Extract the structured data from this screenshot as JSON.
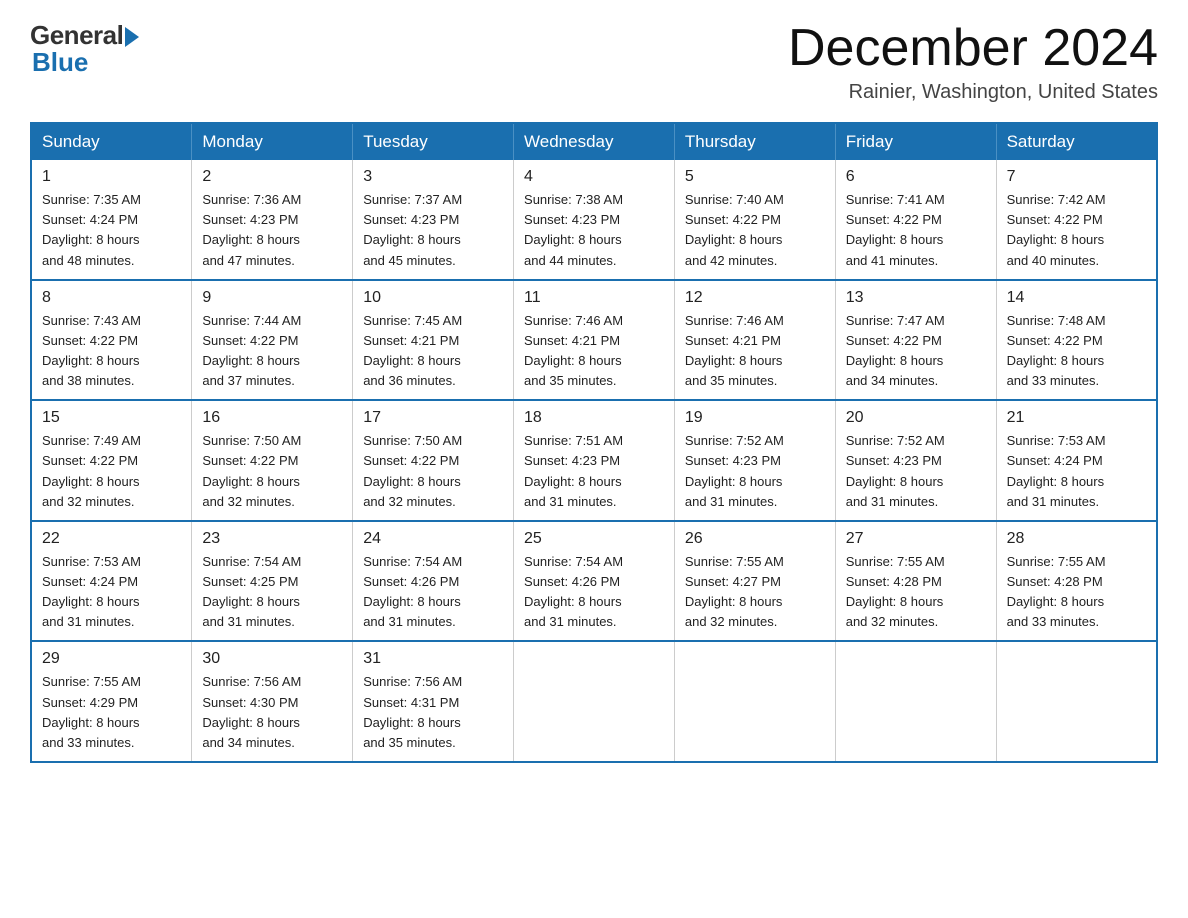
{
  "header": {
    "logo_general": "General",
    "logo_blue": "Blue",
    "month_title": "December 2024",
    "location": "Rainier, Washington, United States"
  },
  "days_of_week": [
    "Sunday",
    "Monday",
    "Tuesday",
    "Wednesday",
    "Thursday",
    "Friday",
    "Saturday"
  ],
  "weeks": [
    [
      {
        "day": "1",
        "sunrise": "7:35 AM",
        "sunset": "4:24 PM",
        "daylight": "8 hours and 48 minutes."
      },
      {
        "day": "2",
        "sunrise": "7:36 AM",
        "sunset": "4:23 PM",
        "daylight": "8 hours and 47 minutes."
      },
      {
        "day": "3",
        "sunrise": "7:37 AM",
        "sunset": "4:23 PM",
        "daylight": "8 hours and 45 minutes."
      },
      {
        "day": "4",
        "sunrise": "7:38 AM",
        "sunset": "4:23 PM",
        "daylight": "8 hours and 44 minutes."
      },
      {
        "day": "5",
        "sunrise": "7:40 AM",
        "sunset": "4:22 PM",
        "daylight": "8 hours and 42 minutes."
      },
      {
        "day": "6",
        "sunrise": "7:41 AM",
        "sunset": "4:22 PM",
        "daylight": "8 hours and 41 minutes."
      },
      {
        "day": "7",
        "sunrise": "7:42 AM",
        "sunset": "4:22 PM",
        "daylight": "8 hours and 40 minutes."
      }
    ],
    [
      {
        "day": "8",
        "sunrise": "7:43 AM",
        "sunset": "4:22 PM",
        "daylight": "8 hours and 38 minutes."
      },
      {
        "day": "9",
        "sunrise": "7:44 AM",
        "sunset": "4:22 PM",
        "daylight": "8 hours and 37 minutes."
      },
      {
        "day": "10",
        "sunrise": "7:45 AM",
        "sunset": "4:21 PM",
        "daylight": "8 hours and 36 minutes."
      },
      {
        "day": "11",
        "sunrise": "7:46 AM",
        "sunset": "4:21 PM",
        "daylight": "8 hours and 35 minutes."
      },
      {
        "day": "12",
        "sunrise": "7:46 AM",
        "sunset": "4:21 PM",
        "daylight": "8 hours and 35 minutes."
      },
      {
        "day": "13",
        "sunrise": "7:47 AM",
        "sunset": "4:22 PM",
        "daylight": "8 hours and 34 minutes."
      },
      {
        "day": "14",
        "sunrise": "7:48 AM",
        "sunset": "4:22 PM",
        "daylight": "8 hours and 33 minutes."
      }
    ],
    [
      {
        "day": "15",
        "sunrise": "7:49 AM",
        "sunset": "4:22 PM",
        "daylight": "8 hours and 32 minutes."
      },
      {
        "day": "16",
        "sunrise": "7:50 AM",
        "sunset": "4:22 PM",
        "daylight": "8 hours and 32 minutes."
      },
      {
        "day": "17",
        "sunrise": "7:50 AM",
        "sunset": "4:22 PM",
        "daylight": "8 hours and 32 minutes."
      },
      {
        "day": "18",
        "sunrise": "7:51 AM",
        "sunset": "4:23 PM",
        "daylight": "8 hours and 31 minutes."
      },
      {
        "day": "19",
        "sunrise": "7:52 AM",
        "sunset": "4:23 PM",
        "daylight": "8 hours and 31 minutes."
      },
      {
        "day": "20",
        "sunrise": "7:52 AM",
        "sunset": "4:23 PM",
        "daylight": "8 hours and 31 minutes."
      },
      {
        "day": "21",
        "sunrise": "7:53 AM",
        "sunset": "4:24 PM",
        "daylight": "8 hours and 31 minutes."
      }
    ],
    [
      {
        "day": "22",
        "sunrise": "7:53 AM",
        "sunset": "4:24 PM",
        "daylight": "8 hours and 31 minutes."
      },
      {
        "day": "23",
        "sunrise": "7:54 AM",
        "sunset": "4:25 PM",
        "daylight": "8 hours and 31 minutes."
      },
      {
        "day": "24",
        "sunrise": "7:54 AM",
        "sunset": "4:26 PM",
        "daylight": "8 hours and 31 minutes."
      },
      {
        "day": "25",
        "sunrise": "7:54 AM",
        "sunset": "4:26 PM",
        "daylight": "8 hours and 31 minutes."
      },
      {
        "day": "26",
        "sunrise": "7:55 AM",
        "sunset": "4:27 PM",
        "daylight": "8 hours and 32 minutes."
      },
      {
        "day": "27",
        "sunrise": "7:55 AM",
        "sunset": "4:28 PM",
        "daylight": "8 hours and 32 minutes."
      },
      {
        "day": "28",
        "sunrise": "7:55 AM",
        "sunset": "4:28 PM",
        "daylight": "8 hours and 33 minutes."
      }
    ],
    [
      {
        "day": "29",
        "sunrise": "7:55 AM",
        "sunset": "4:29 PM",
        "daylight": "8 hours and 33 minutes."
      },
      {
        "day": "30",
        "sunrise": "7:56 AM",
        "sunset": "4:30 PM",
        "daylight": "8 hours and 34 minutes."
      },
      {
        "day": "31",
        "sunrise": "7:56 AM",
        "sunset": "4:31 PM",
        "daylight": "8 hours and 35 minutes."
      },
      null,
      null,
      null,
      null
    ]
  ],
  "labels": {
    "sunrise": "Sunrise: ",
    "sunset": "Sunset: ",
    "daylight": "Daylight: "
  }
}
